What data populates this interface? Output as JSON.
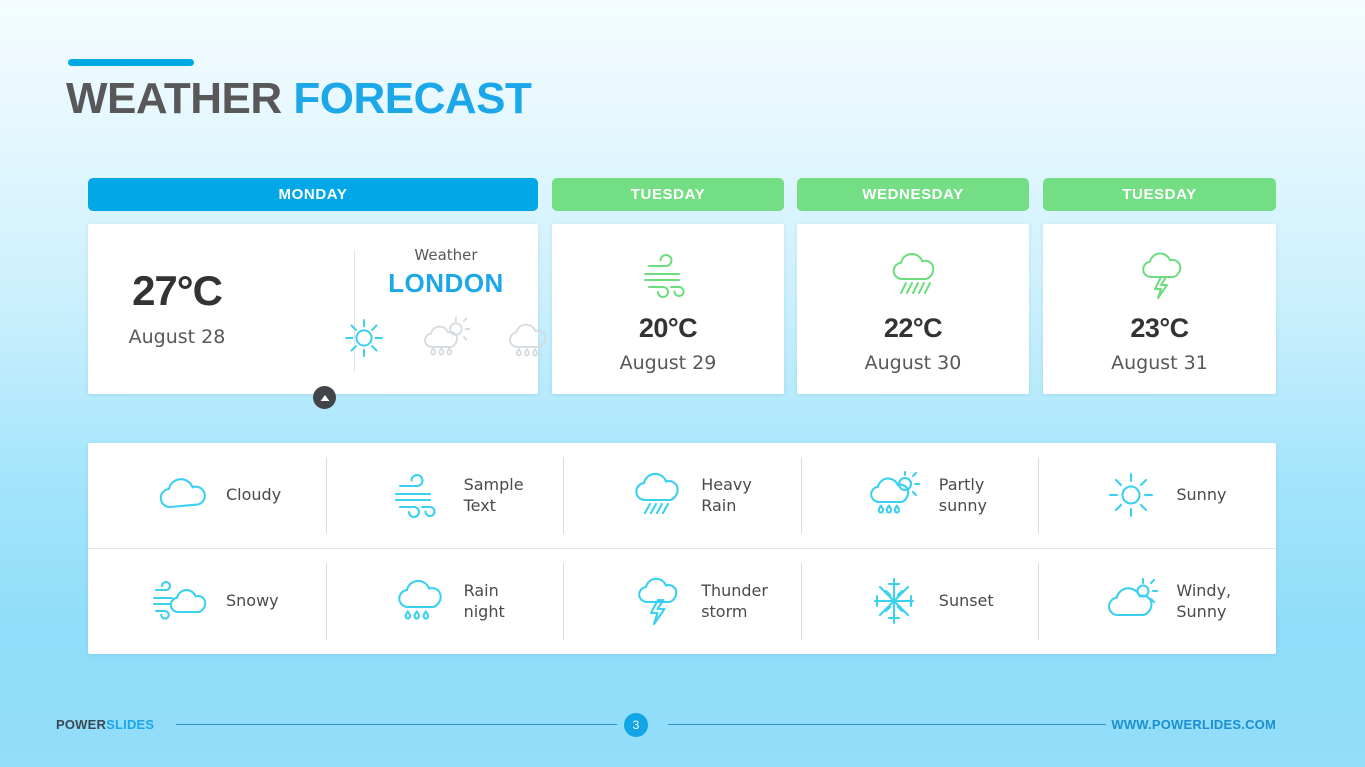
{
  "title": {
    "primary": "WEATHER",
    "accent": "FORECAST"
  },
  "colors": {
    "accent_blue": "#1ba7e8",
    "bar_blue": "#02a7e8",
    "bar_green": "#74de84",
    "icon_cyan": "#3ad0f0",
    "icon_gray": "#d5dade",
    "text_dark": "#333334"
  },
  "days": [
    {
      "name": "MONDAY",
      "bar_color": "#02a7e8",
      "temperature": "27°C",
      "date": "August 28",
      "icon": "sun-icon"
    },
    {
      "name": "TUESDAY",
      "bar_color": "#74de84",
      "temperature": "20°C",
      "date": "August 29",
      "icon": "wind-icon"
    },
    {
      "name": "WEDNESDAY",
      "bar_color": "#74de84",
      "temperature": "22°C",
      "date": "August 30",
      "icon": "rain-cloud-icon"
    },
    {
      "name": "TUESDAY",
      "bar_color": "#74de84",
      "temperature": "23°C",
      "date": "August 31",
      "icon": "thunderstorm-icon"
    }
  ],
  "featured": {
    "temperature": "27°C",
    "date": "August 28",
    "weather_label": "Weather",
    "city": "LONDON",
    "icons": [
      {
        "name": "sun-icon",
        "active": true
      },
      {
        "name": "partly-sunny-rain-icon",
        "active": false
      },
      {
        "name": "rain-cloud-icon",
        "active": false
      }
    ]
  },
  "legend": {
    "rows": [
      [
        {
          "icon": "cloudy-icon",
          "label": "Cloudy"
        },
        {
          "icon": "wind-icon",
          "label": "Sample\nText"
        },
        {
          "icon": "heavy-rain-icon",
          "label": "Heavy\nRain"
        },
        {
          "icon": "partly-sunny-icon",
          "label": "Partly\nsunny"
        },
        {
          "icon": "sun-icon",
          "label": "Sunny"
        }
      ],
      [
        {
          "icon": "snowy-icon",
          "label": "Snowy"
        },
        {
          "icon": "rain-night-icon",
          "label": "Rain\nnight"
        },
        {
          "icon": "thunderstorm-icon",
          "label": "Thunder\nstorm"
        },
        {
          "icon": "sunset-icon",
          "label": "Sunset"
        },
        {
          "icon": "windy-sunny-icon",
          "label": "Windy,\nSunny"
        }
      ]
    ]
  },
  "footer": {
    "brand_primary": "POWER",
    "brand_accent": "SLIDES",
    "page_number": "3",
    "url": "WWW.POWERLIDES.COM"
  }
}
